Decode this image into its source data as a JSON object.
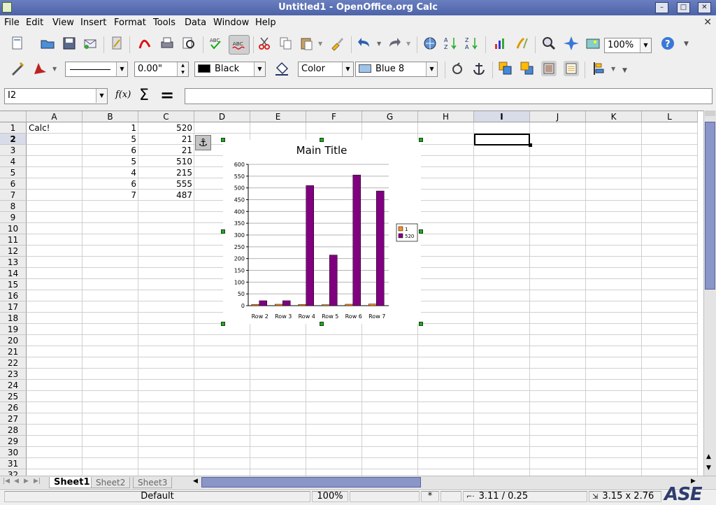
{
  "window": {
    "title": "Untitled1 - OpenOffice.org Calc",
    "minimize": "–",
    "maximize": "□",
    "close": "✕"
  },
  "menu": [
    "File",
    "Edit",
    "View",
    "Insert",
    "Format",
    "Tools",
    "Data",
    "Window",
    "Help"
  ],
  "toolbar": {
    "zoom_value": "100%",
    "line_width": "0.00\"",
    "line_color": "Black",
    "area_style": "Color",
    "area_color": "Blue 8",
    "line_color_hex": "#000000",
    "area_color_hex": "#9ec4ea"
  },
  "formula": {
    "name_box": "I2",
    "function_icon": "f(x)",
    "sum_icon": "Σ",
    "equals_icon": "=",
    "input": ""
  },
  "columns": [
    "A",
    "B",
    "C",
    "D",
    "E",
    "F",
    "G",
    "H",
    "I",
    "J",
    "K",
    "L"
  ],
  "rows": [
    "1",
    "2",
    "3",
    "4",
    "5",
    "6",
    "7",
    "8",
    "9",
    "10",
    "11",
    "12",
    "13",
    "14",
    "15",
    "16",
    "17",
    "18",
    "19",
    "20",
    "21",
    "22",
    "23",
    "24",
    "25",
    "26",
    "27",
    "28",
    "29",
    "30",
    "31",
    "32"
  ],
  "cells": {
    "A1": "Calc!",
    "B": [
      "1",
      "5",
      "6",
      "5",
      "4",
      "6",
      "7"
    ],
    "C": [
      "520",
      "21",
      "21",
      "510",
      "215",
      "555",
      "487"
    ]
  },
  "chart_data": {
    "type": "bar",
    "title": "Main Title",
    "categories": [
      "Row 2",
      "Row 3",
      "Row 4",
      "Row 5",
      "Row 6",
      "Row 7"
    ],
    "series": [
      {
        "name": "1",
        "values": [
          5,
          6,
          5,
          4,
          6,
          7
        ],
        "color": "#ff8c1a"
      },
      {
        "name": "520",
        "values": [
          21,
          21,
          510,
          215,
          555,
          487
        ],
        "color": "#800080"
      }
    ],
    "ylim": [
      0,
      600
    ],
    "yticks": [
      0,
      50,
      100,
      150,
      200,
      250,
      300,
      350,
      400,
      450,
      500,
      550,
      600
    ],
    "grid": true,
    "legend": "right"
  },
  "sheets": [
    "Sheet1",
    "Sheet2",
    "Sheet3"
  ],
  "status": {
    "style": "Default",
    "zoom": "100%",
    "mode": "*",
    "position": "3.11 / 0.25",
    "size": "3.15 x 2.76"
  },
  "logo": "ASE"
}
